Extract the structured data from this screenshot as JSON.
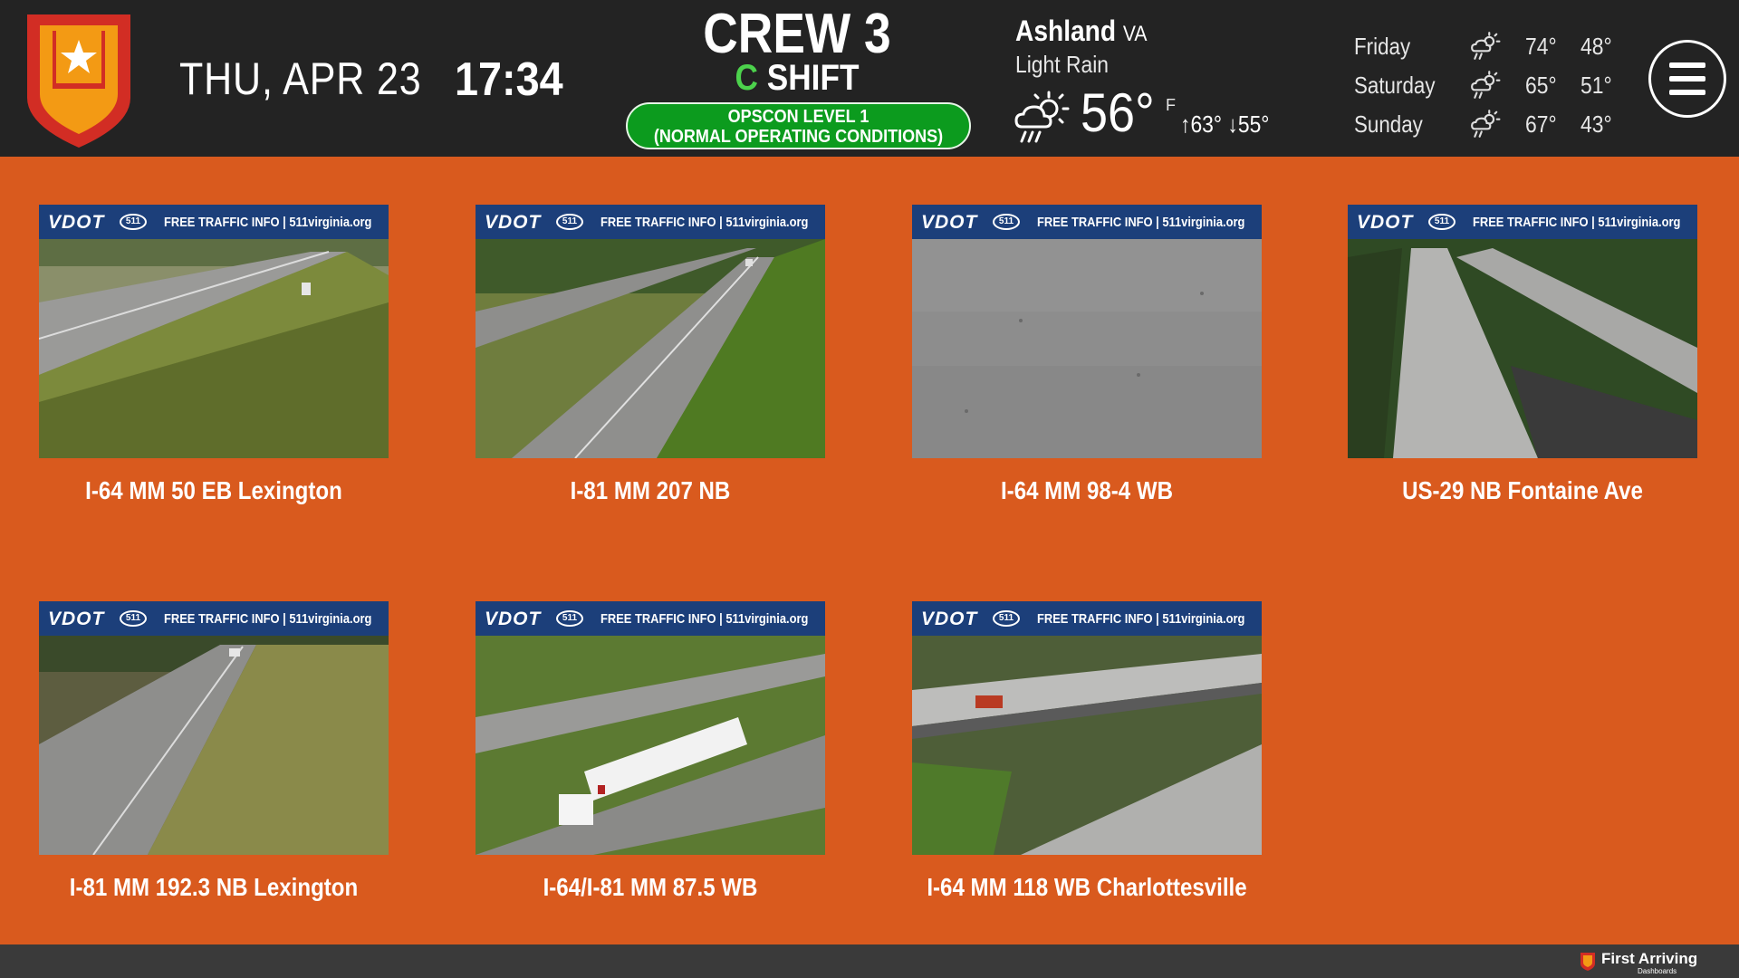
{
  "header": {
    "date": "THU, APR 23",
    "time": "17:34",
    "crew": "CREW 3",
    "shift_letter": "C",
    "shift_word": "SHIFT",
    "opscon_line1": "OPSCON LEVEL 1",
    "opscon_line2": "(NORMAL OPERATING CONDITIONS)"
  },
  "weather": {
    "city": "Ashland",
    "state": "VA",
    "condition": "Light Rain",
    "temp": "56°",
    "unit": "F",
    "high": "63°",
    "low": "55°",
    "icon": "rain-sun-icon",
    "forecast": [
      {
        "day": "Friday",
        "high": "74°",
        "low": "48°",
        "icon": "rain-sun-icon"
      },
      {
        "day": "Saturday",
        "high": "65°",
        "low": "51°",
        "icon": "rain-sun-icon"
      },
      {
        "day": "Sunday",
        "high": "67°",
        "low": "43°",
        "icon": "rain-sun-icon"
      }
    ]
  },
  "camera_banner": {
    "brand": "VDOT",
    "badge": "511",
    "text": "FREE TRAFFIC INFO | 511virginia.org"
  },
  "cameras": [
    {
      "label": "I-64 MM 50 EB Lexington"
    },
    {
      "label": "I-81 MM 207 NB"
    },
    {
      "label": "I-64 MM 98-4 WB"
    },
    {
      "label": "US-29 NB Fontaine Ave"
    },
    {
      "label": "I-81 MM 192.3 NB Lexington"
    },
    {
      "label": "I-64/I-81 MM 87.5 WB"
    },
    {
      "label": "I-64 MM 118 WB Charlottesville"
    }
  ],
  "footer": {
    "brand": "First Arriving",
    "sub": "Dashboards"
  },
  "colors": {
    "background": "#d95a1e",
    "header": "#232323",
    "opscon_green": "#0c9b1e",
    "shift_green": "#4cd24c",
    "banner_blue": "#1c3f7a"
  }
}
